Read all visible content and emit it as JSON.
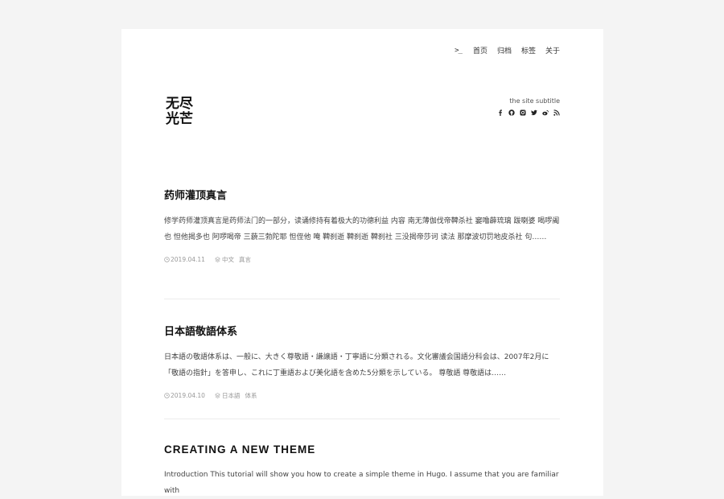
{
  "nav": {
    "terminal_icon": ">_",
    "items": [
      "首页",
      "归档",
      "标签",
      "关于"
    ]
  },
  "logo": {
    "line1": "无尽",
    "line2": "光芒"
  },
  "subtitle": "the site subtitle",
  "social_icons": [
    "facebook-icon",
    "github-icon",
    "instagram-icon",
    "twitter-icon",
    "weibo-icon",
    "rss-icon"
  ],
  "posts": [
    {
      "title": "药师灌顶真言",
      "excerpt": "修学药师灌顶真言是药师法门的一部分，读诵修持有着极大的功德利益 内容 南无薄伽伐帝鞞杀社 窭噜薜琉璃 跋喇婆 喝啰阇也 怛他揭多也 阿啰喝帝 三藐三勃陀耶 怛侄他 唵 鞞刹逝 鞞刹逝 鞞刹社 三没揭帝莎诃 读法 那摩波切罚地皮杀社 句……",
      "date": "2019.04.11",
      "tags": [
        "中文",
        "真言"
      ]
    },
    {
      "title": "日本語敬語体系",
      "excerpt": "日本語の敬語体系は、一般に、大きく尊敬語・謙譲語・丁寧語に分類される。文化審議会国語分科会は、2007年2月に「敬語の指針」を答申し、これに丁重語および美化語を含めた5分類を示している。 尊敬語 尊敬語は……",
      "date": "2019.04.10",
      "tags": [
        "日本語",
        "体系"
      ]
    },
    {
      "title": "CREATING A NEW THEME",
      "excerpt": "Introduction This tutorial will show you how to create a simple theme in Hugo. I assume that you are familiar with"
    }
  ],
  "colors": {
    "background": "#f4f4f4",
    "card": "#ffffff",
    "meta": "#999999",
    "divider": "#ececec"
  }
}
